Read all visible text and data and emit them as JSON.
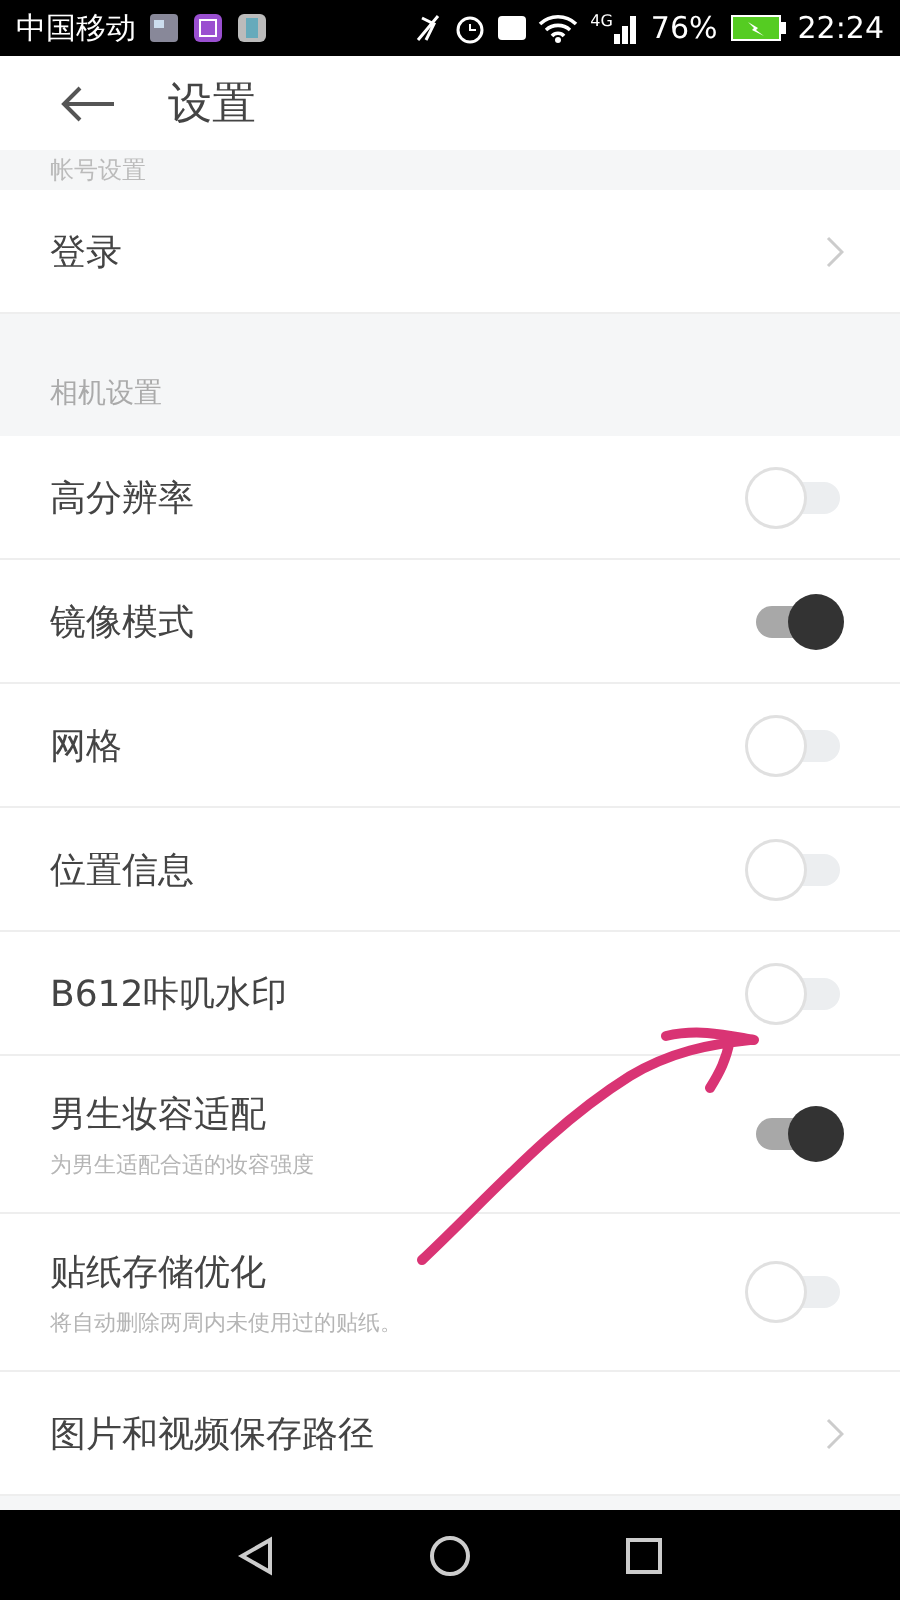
{
  "status_bar": {
    "carrier": "中国移动",
    "network": "4G",
    "battery_text": "76%",
    "time": "22:24"
  },
  "header": {
    "title": "设置"
  },
  "sections": [
    {
      "title": "帐号设置",
      "items": [
        {
          "kind": "link",
          "label": "登录"
        }
      ]
    },
    {
      "title": "相机设置",
      "items": [
        {
          "kind": "toggle",
          "label": "高分辨率",
          "on": false
        },
        {
          "kind": "toggle",
          "label": "镜像模式",
          "on": true
        },
        {
          "kind": "toggle",
          "label": "网格",
          "on": false
        },
        {
          "kind": "toggle",
          "label": "位置信息",
          "on": false
        },
        {
          "kind": "toggle",
          "label": "B612咔叽水印",
          "on": false
        },
        {
          "kind": "toggle",
          "label": "男生妆容适配",
          "description": "为男生适配合适的妆容强度",
          "on": true
        },
        {
          "kind": "toggle",
          "label": "贴纸存储优化",
          "description": "将自动删除两周内未使用过的贴纸。",
          "on": false
        },
        {
          "kind": "link",
          "label": "图片和视频保存路径"
        }
      ]
    }
  ]
}
